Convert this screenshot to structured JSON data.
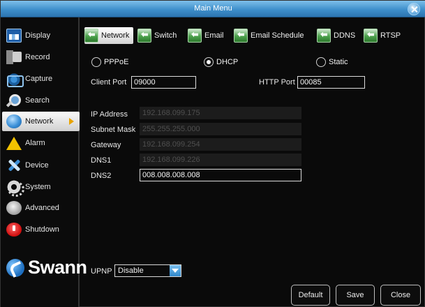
{
  "window": {
    "title": "Main Menu"
  },
  "sidebar": {
    "items": [
      {
        "label": "Display",
        "icon": "display-icon"
      },
      {
        "label": "Record",
        "icon": "record-icon"
      },
      {
        "label": "Capture",
        "icon": "capture-icon"
      },
      {
        "label": "Search",
        "icon": "search-icon"
      },
      {
        "label": "Network",
        "icon": "network-icon",
        "active": true
      },
      {
        "label": "Alarm",
        "icon": "alarm-icon"
      },
      {
        "label": "Device",
        "icon": "device-icon"
      },
      {
        "label": "System",
        "icon": "system-icon"
      },
      {
        "label": "Advanced",
        "icon": "advanced-icon"
      },
      {
        "label": "Shutdown",
        "icon": "shutdown-icon"
      }
    ],
    "logo_text": "Swann"
  },
  "tabs": [
    {
      "label": "Network",
      "active": true
    },
    {
      "label": "Switch"
    },
    {
      "label": "Email"
    },
    {
      "label": "Email Schedule"
    },
    {
      "label": "DDNS"
    },
    {
      "label": "RTSP"
    }
  ],
  "connection_mode": {
    "options": [
      "PPPoE",
      "DHCP",
      "Static"
    ],
    "selected": "DHCP"
  },
  "ports": {
    "client_port_label": "Client Port",
    "client_port_value": "09000",
    "http_port_label": "HTTP Port",
    "http_port_value": "00085"
  },
  "addressing": {
    "ip_label": "IP Address",
    "ip_value": "192.168.099.175",
    "subnet_label": "Subnet Mask",
    "subnet_value": "255.255.255.000",
    "gateway_label": "Gateway",
    "gateway_value": "192.168.099.254",
    "dns1_label": "DNS1",
    "dns1_value": "192.168.099.226",
    "dns2_label": "DNS2",
    "dns2_value": "008.008.008.008"
  },
  "upnp": {
    "label": "UPNP",
    "value": "Disable"
  },
  "buttons": {
    "default": "Default",
    "save": "Save",
    "close": "Close"
  },
  "colors": {
    "titlebar": "#3e8fcb",
    "tab_icon": "#4da24d",
    "accent_arrow": "#e8a400"
  }
}
